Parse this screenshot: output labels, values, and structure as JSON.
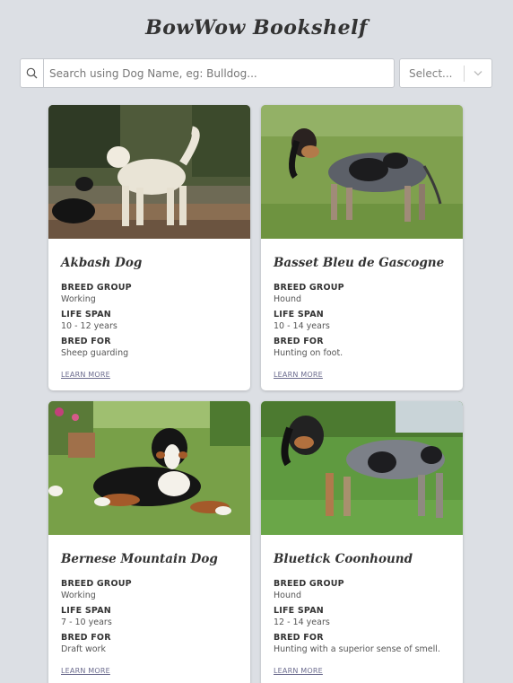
{
  "app": {
    "title": "BowWow Bookshelf"
  },
  "search": {
    "placeholder": "Search using Dog Name, eg: Bulldog..."
  },
  "filter": {
    "selected": "Select..."
  },
  "labels": {
    "breed_group": "BREED GROUP",
    "life_span": "LIFE SPAN",
    "bred_for": "BRED FOR",
    "learn_more": "LEARN MORE"
  },
  "colors": {
    "background": "#dcdfe4",
    "card": "#ffffff",
    "link": "#6b6b8e",
    "text": "#333333"
  },
  "dogs": [
    {
      "name": "Akbash Dog",
      "breed_group": "Working",
      "life_span": "10 - 12 years",
      "bred_for": "Sheep guarding",
      "image": "white dog standing beside black goat on dirt ground"
    },
    {
      "name": "Basset Bleu de Gascogne",
      "breed_group": "Hound",
      "life_span": "10 - 14 years",
      "bred_for": "Hunting on foot.",
      "image": "blue-ticked hound with long ears on grass"
    },
    {
      "name": "Bernese Mountain Dog",
      "breed_group": "Working",
      "life_span": "7 - 10 years",
      "bred_for": "Draft work",
      "image": "tricolor dog lying on lawn near flower pots"
    },
    {
      "name": "Bluetick Coonhound",
      "breed_group": "Hound",
      "life_span": "12 - 14 years",
      "bred_for": "Hunting with a superior sense of smell.",
      "image": "blue-ticked hound standing on grass"
    }
  ]
}
